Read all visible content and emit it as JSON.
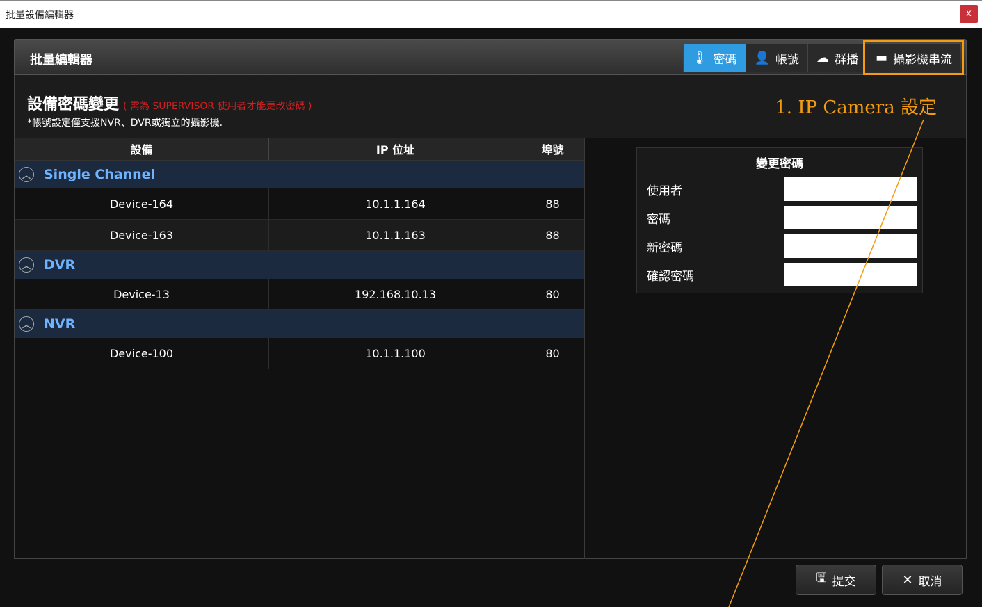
{
  "window": {
    "title": "批量設備編輯器",
    "close_label": "x"
  },
  "panel": {
    "title": "批量編輯器"
  },
  "tabs": [
    {
      "label": "密碼",
      "icon": "thermometer-icon"
    },
    {
      "label": "帳號",
      "icon": "user-icon"
    },
    {
      "label": "群播",
      "icon": "cloud-icon"
    },
    {
      "label": "攝影機串流",
      "icon": "camera-stream-icon"
    }
  ],
  "section": {
    "heading": "設備密碼變更",
    "warning": "( 需為 SUPERVISOR 使用者才能更改密碼 )",
    "note": "*帳號設定僅支援NVR、DVR或獨立的攝影機."
  },
  "annotation": {
    "text": "1. IP Camera 設定",
    "color": "#f39c12"
  },
  "table": {
    "headers": [
      "設備",
      "IP 位址",
      "埠號"
    ],
    "groups": [
      {
        "name": "Single Channel",
        "rows": [
          {
            "device": "Device-164",
            "ip": "10.1.1.164",
            "port": "88"
          },
          {
            "device": "Device-163",
            "ip": "10.1.1.163",
            "port": "88"
          }
        ]
      },
      {
        "name": "DVR",
        "rows": [
          {
            "device": "Device-13",
            "ip": "192.168.10.13",
            "port": "80"
          }
        ]
      },
      {
        "name": "NVR",
        "rows": [
          {
            "device": "Device-100",
            "ip": "10.1.1.100",
            "port": "80"
          }
        ]
      }
    ]
  },
  "form": {
    "title": "變更密碼",
    "fields": [
      {
        "label": "使用者",
        "value": ""
      },
      {
        "label": "密碼",
        "value": ""
      },
      {
        "label": "新密碼",
        "value": ""
      },
      {
        "label": "確認密碼",
        "value": ""
      }
    ]
  },
  "buttons": {
    "submit": "提交",
    "cancel": "取消"
  },
  "colors": {
    "accent": "#2f9be0",
    "group_text": "#6fb3ff",
    "warning": "#d02020"
  }
}
